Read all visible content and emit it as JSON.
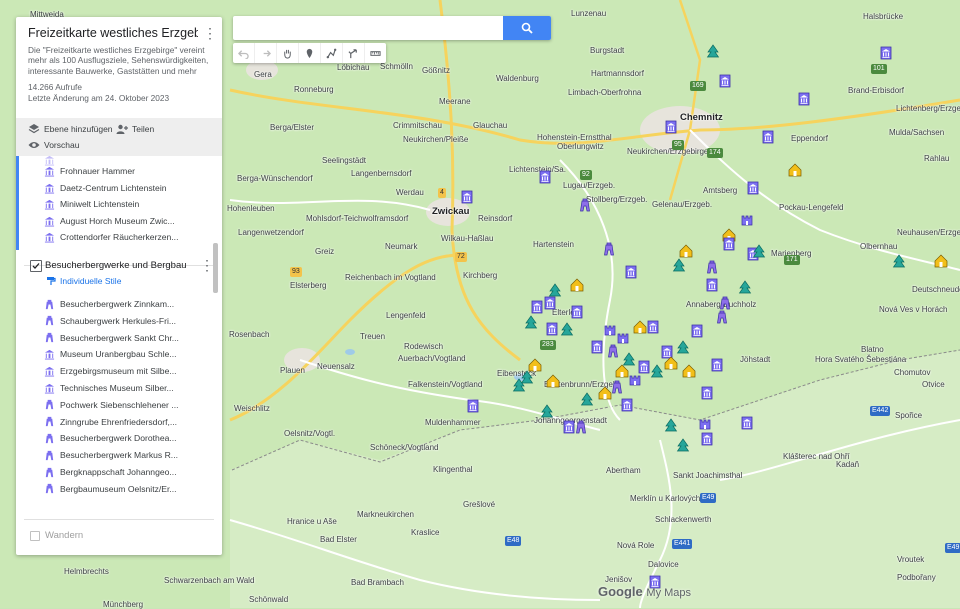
{
  "map": {
    "towns": [
      {
        "name": "Mittweida",
        "cls": ""
      },
      {
        "name": "Zwickau",
        "cls": "big"
      },
      {
        "name": "Chemnitz",
        "cls": "big"
      },
      {
        "name": "Lunzenau",
        "cls": ""
      },
      {
        "name": "Burgstadt",
        "cls": ""
      },
      {
        "name": "Gera",
        "cls": ""
      },
      {
        "name": "Ronneburg",
        "cls": ""
      },
      {
        "name": "Löbichau",
        "cls": ""
      },
      {
        "name": "Schmölln",
        "cls": ""
      },
      {
        "name": "Gößnitz",
        "cls": ""
      },
      {
        "name": "Waldenburg",
        "cls": ""
      },
      {
        "name": "Hartmannsdorf",
        "cls": ""
      },
      {
        "name": "Limbach-Oberfrohna",
        "cls": ""
      },
      {
        "name": "Meerane",
        "cls": ""
      },
      {
        "name": "Crimmitschau",
        "cls": ""
      },
      {
        "name": "Glauchau",
        "cls": ""
      },
      {
        "name": "Hohenstein-Ernstthal",
        "cls": ""
      },
      {
        "name": "Oberlungwitz",
        "cls": ""
      },
      {
        "name": "Seelingstädt",
        "cls": ""
      },
      {
        "name": "Neukirchen/Pleiße",
        "cls": ""
      },
      {
        "name": "Berga/Elster",
        "cls": ""
      },
      {
        "name": "Langenbernsdorf",
        "cls": ""
      },
      {
        "name": "Werdau",
        "cls": ""
      },
      {
        "name": "Lichtenstein/Sa.",
        "cls": ""
      },
      {
        "name": "Lugau/Erzgeb.",
        "cls": ""
      },
      {
        "name": "Stollberg/Erzgeb.",
        "cls": ""
      },
      {
        "name": "Hohenleuben",
        "cls": ""
      },
      {
        "name": "Mohlsdorf-Teichwolframsdorf",
        "cls": ""
      },
      {
        "name": "Reinsdorf",
        "cls": ""
      },
      {
        "name": "Wilkau-Haßlau",
        "cls": ""
      },
      {
        "name": "Langenwetzendorf",
        "cls": ""
      },
      {
        "name": "Neumark",
        "cls": ""
      },
      {
        "name": "Hartenstein",
        "cls": ""
      },
      {
        "name": "Greiz",
        "cls": ""
      },
      {
        "name": "Reichenbach im Vogtland",
        "cls": ""
      },
      {
        "name": "Kirchberg",
        "cls": ""
      },
      {
        "name": "Elsterberg",
        "cls": ""
      },
      {
        "name": "Lengenfeld",
        "cls": ""
      },
      {
        "name": "Treuen",
        "cls": ""
      },
      {
        "name": "Rodewisch",
        "cls": ""
      },
      {
        "name": "Auerbach/Vogtland",
        "cls": ""
      },
      {
        "name": "Plauen",
        "cls": ""
      },
      {
        "name": "Neuensalz",
        "cls": ""
      },
      {
        "name": "Falkenstein/Vogtland",
        "cls": ""
      },
      {
        "name": "Rosenbach",
        "cls": ""
      },
      {
        "name": "Weischlitz",
        "cls": ""
      },
      {
        "name": "Muldenhammer",
        "cls": ""
      },
      {
        "name": "Oelsnitz/Vogtl.",
        "cls": ""
      },
      {
        "name": "Schöneck/Vogtland",
        "cls": ""
      },
      {
        "name": "Klingenthal",
        "cls": ""
      },
      {
        "name": "Markneukirchen",
        "cls": ""
      },
      {
        "name": "Grešlové",
        "cls": ""
      },
      {
        "name": "Kraslice",
        "cls": ""
      },
      {
        "name": "Hranice u Aše",
        "cls": ""
      },
      {
        "name": "Bad Elster",
        "cls": ""
      },
      {
        "name": "Bad Brambach",
        "cls": ""
      },
      {
        "name": "Abertham",
        "cls": ""
      },
      {
        "name": "Sankt Joachimsthal",
        "cls": ""
      },
      {
        "name": "Merklín u Karlových Var",
        "cls": ""
      },
      {
        "name": "Schlackenwerth",
        "cls": ""
      },
      {
        "name": "Nová Role",
        "cls": ""
      },
      {
        "name": "Dalovice",
        "cls": ""
      },
      {
        "name": "Jenišov",
        "cls": ""
      },
      {
        "name": "Helmbrechts",
        "cls": ""
      },
      {
        "name": "Schwarzenbach am Wald",
        "cls": ""
      },
      {
        "name": "Schönwald",
        "cls": ""
      },
      {
        "name": "Münchberg",
        "cls": ""
      },
      {
        "name": "Halsbrücke",
        "cls": ""
      },
      {
        "name": "Brand-Erbisdorf",
        "cls": ""
      },
      {
        "name": "Lichtenberg/Erzgebirge",
        "cls": ""
      },
      {
        "name": "Mulda/Sachsen",
        "cls": ""
      },
      {
        "name": "Eppendorf",
        "cls": ""
      },
      {
        "name": "Amtsberg",
        "cls": ""
      },
      {
        "name": "Gelenau/Erzgeb.",
        "cls": ""
      },
      {
        "name": "Pockau-Lengefeld",
        "cls": ""
      },
      {
        "name": "Marienberg",
        "cls": ""
      },
      {
        "name": "Olbernhau",
        "cls": ""
      },
      {
        "name": "Neuhausen/Erzgebirge",
        "cls": ""
      },
      {
        "name": "Deutschneudorf",
        "cls": ""
      },
      {
        "name": "Jöhstadt",
        "cls": ""
      },
      {
        "name": "Nová Ves v Horách",
        "cls": ""
      },
      {
        "name": "Hora Svatého Šebestiána",
        "cls": ""
      },
      {
        "name": "Blatno",
        "cls": ""
      },
      {
        "name": "Chomutov",
        "cls": ""
      },
      {
        "name": "Otvice",
        "cls": ""
      },
      {
        "name": "Spořice",
        "cls": ""
      },
      {
        "name": "Klášterec nad Ohří",
        "cls": ""
      },
      {
        "name": "Kadaň",
        "cls": ""
      },
      {
        "name": "Podbořany",
        "cls": ""
      },
      {
        "name": "Vroutek",
        "cls": ""
      },
      {
        "name": "Rahlau",
        "cls": ""
      },
      {
        "name": "Neukirchen/Erzgebirge",
        "cls": ""
      },
      {
        "name": "Berga-Wünschendorf",
        "cls": ""
      },
      {
        "name": "Johanngeorgenstadt",
        "cls": ""
      },
      {
        "name": "Eibenstock",
        "cls": ""
      },
      {
        "name": "Annaberg-Buchholz",
        "cls": ""
      },
      {
        "name": "Elterlein",
        "cls": ""
      },
      {
        "name": "Breitenbrunn/Erzgeb.",
        "cls": ""
      }
    ],
    "roads": [
      "72",
      "4",
      "93",
      "95",
      "174",
      "101",
      "169",
      "171",
      "283",
      "92",
      "E442",
      "E49",
      "E441",
      "E48",
      "E49"
    ]
  },
  "panel": {
    "title": "Freizeitkarte westliches Erzgebir...",
    "description": "Die \"Freizeitkarte westliches Erzgebirge\" vereint mehr als 100 Ausflugsziele, Sehenswürdigkeiten, interessante Bauwerke, Gaststätten und mehr",
    "views": "14.266 Aufrufe",
    "updated": "Letzte Änderung am 24. Oktober 2023",
    "add_layer": "Ebene hinzufügen",
    "share": "Teilen",
    "preview": "Vorschau",
    "layer1_items": [
      "Frohnauer Hammer",
      "Daetz-Centrum Lichtenstein",
      "Miniwelt Lichtenstein",
      "August Horch Museum Zwic...",
      "Crottendorfer Räucherkerzen..."
    ],
    "layer2": {
      "title": "Besucherbergwerke und Bergbau",
      "styles": "Individuelle Stile",
      "items": [
        "Besucherbergwerk Zinnkam...",
        "Schaubergwerk Herkules-Fri...",
        "Besucherbergwerk Sankt Chr...",
        "Museum Uranbergbau Schle...",
        "Erzgebirgsmuseum mit Silbe...",
        "Technisches Museum Silber...",
        "Pochwerk Siebenschlehener ...",
        "Zinngrube Ehrenfriedersdorf,...",
        "Besucherbergwerk Dorothea...",
        "Besucherbergwerk Markus R...",
        "Bergknappschaft Johanngeo...",
        "Bergbaumuseum Oelsnitz/Er..."
      ]
    },
    "layer3": "Wandern"
  },
  "search": {
    "placeholder": ""
  },
  "logo": {
    "google": "Google",
    "mymaps": "My Maps"
  },
  "colors": {
    "museum": "#7c6ff0",
    "mine": "#8e6fe8",
    "castle": "#7c6ff0",
    "food": "#f2bf1a",
    "nature": "#26a69a",
    "accent": "#4285f4"
  }
}
